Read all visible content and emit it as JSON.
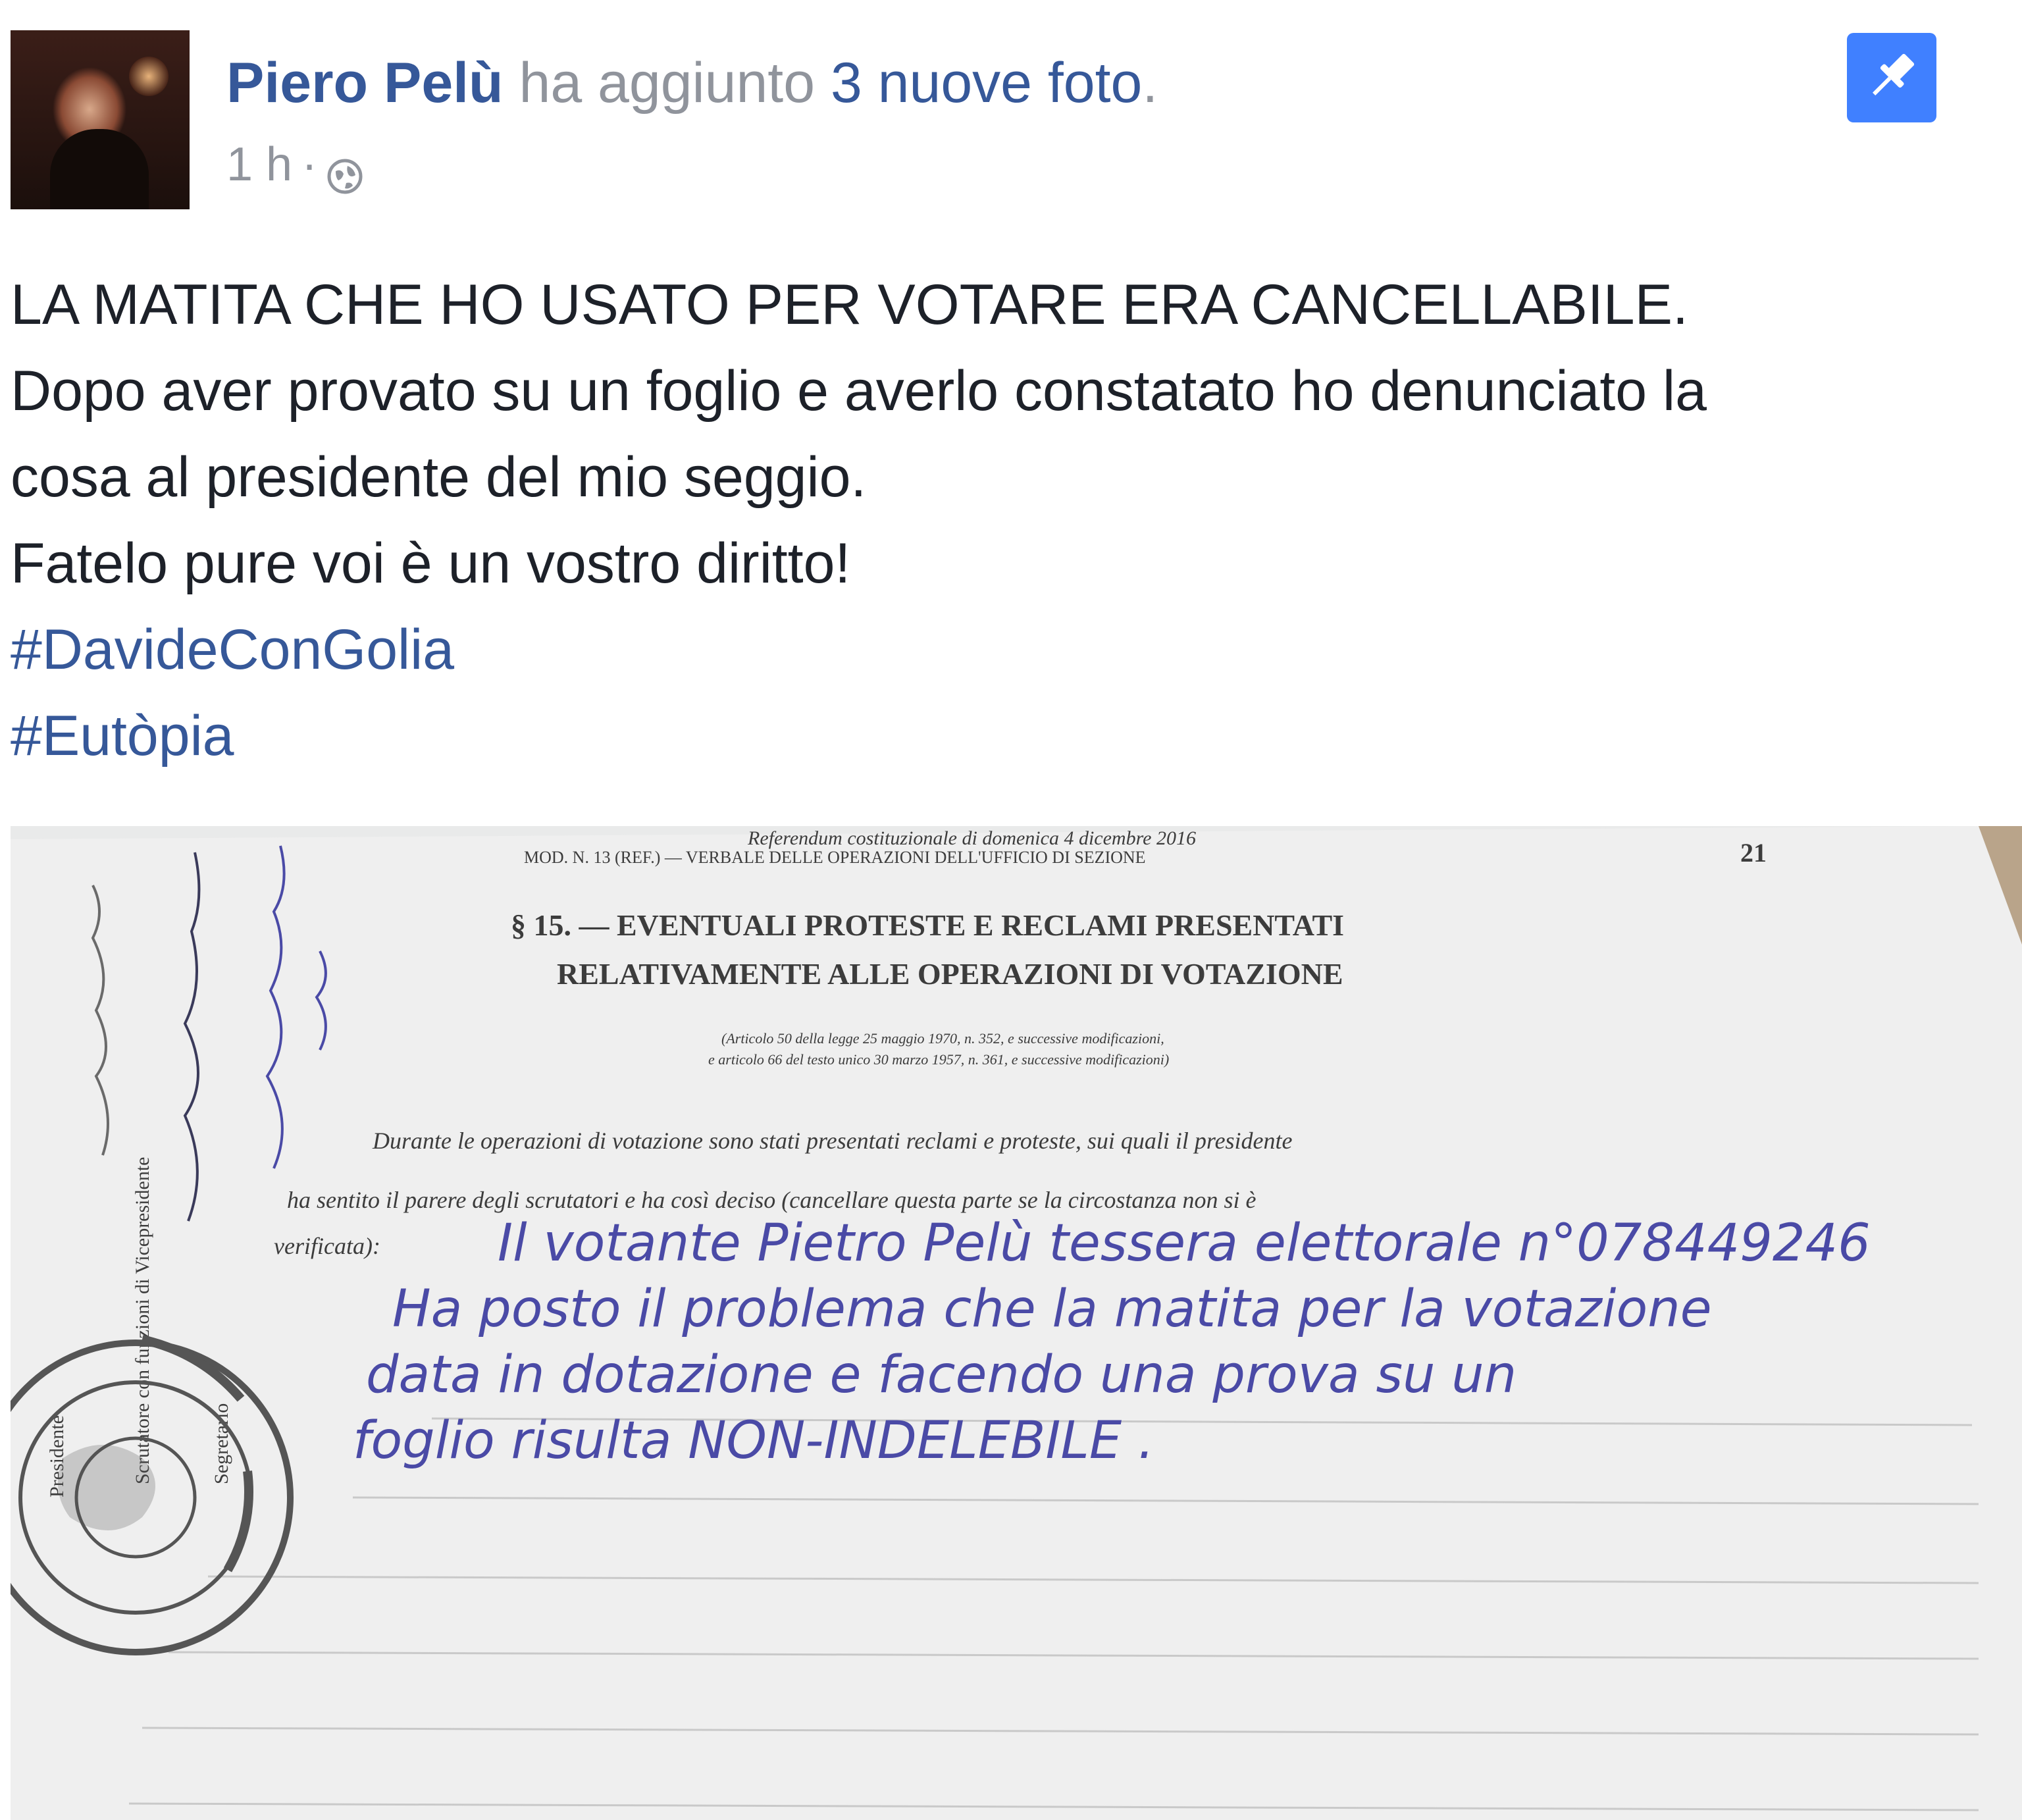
{
  "post": {
    "author": "Piero Pelù",
    "action": "ha aggiunto",
    "photo_link": "3 nuove foto",
    "action_end": ".",
    "time": "1 h",
    "separator": "·",
    "privacy_icon": "globe-icon",
    "pin_icon": "pin-icon",
    "body": [
      "LA MATITA CHE HO USATO PER VOTARE ERA CANCELLABILE.",
      "Dopo aver provato su un foglio e averlo constatato ho denunciato la",
      "cosa al presidente del mio seggio.",
      "Fatelo pure voi è un vostro diritto!"
    ],
    "hashtags": [
      "#DavideConGolia",
      "#Eutòpia"
    ]
  },
  "document": {
    "top_line": "Referendum costituzionale di domenica 4 dicembre 2016",
    "header": "MOD. N. 13 (REF.) — VERBALE DELLE OPERAZIONI DELL'UFFICIO DI SEZIONE",
    "page_number": "21",
    "section_title_1": "§ 15. — EVENTUALI PROTESTE E RECLAMI PRESENTATI",
    "section_title_2": "RELATIVAMENTE ALLE OPERAZIONI DI VOTAZIONE",
    "reference_1": "(Articolo 50 della legge 25 maggio 1970, n. 352, e successive modificazioni,",
    "reference_2": "e articolo 66 del testo unico 30 marzo 1957, n. 361, e successive modificazioni)",
    "paragraph_1": "Durante le operazioni di votazione sono stati presentati reclami e proteste, sui quali il presidente",
    "paragraph_2": "ha sentito il parere degli scrutatori e ha così deciso (cancellare questa parte se la circostanza non si è",
    "paragraph_3": "verificata):",
    "handwritten": [
      "Il votante Pietro Pelù tessera elettorale n°078449246",
      "Ha posto il problema che la matita per la votazione",
      "data in dotazione e facendo una prova su un",
      "foglio risulta NON-INDELEBILE ."
    ],
    "margin_labels": [
      "Presidente",
      "Scrutatore con funzioni di Vicepresidente",
      "Segretario"
    ]
  },
  "colors": {
    "link": "#365899",
    "meta": "#90949c",
    "text": "#1d2129",
    "pin_bg": "#4080ff",
    "ink": "#4a4aa6"
  }
}
